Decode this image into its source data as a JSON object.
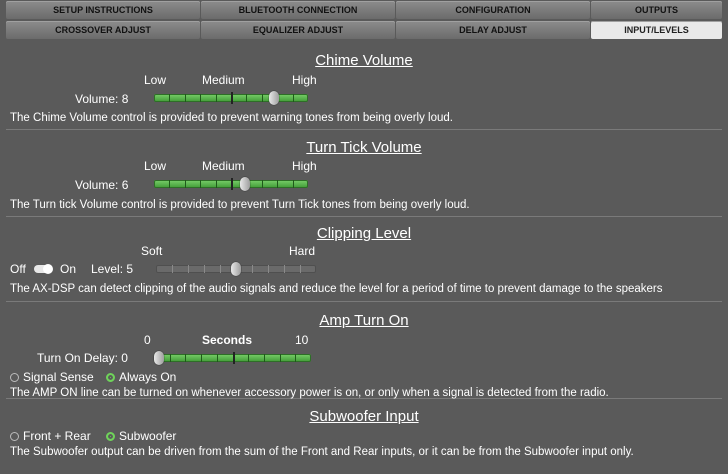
{
  "tabs": {
    "row1": [
      "SETUP INSTRUCTIONS",
      "BLUETOOTH CONNECTION",
      "CONFIGURATION",
      "OUTPUTS"
    ],
    "row2": [
      "CROSSOVER ADJUST",
      "EQUALIZER ADJUST",
      "DELAY ADJUST",
      "INPUT/LEVELS"
    ],
    "active": "INPUT/LEVELS"
  },
  "chime": {
    "title": "Chime Volume",
    "low": "Low",
    "medium": "Medium",
    "high": "High",
    "volume_label": "Volume: 8",
    "value": 8,
    "min": 0,
    "max": 10,
    "desc": "The Chime Volume control is provided to prevent warning tones from being overly loud."
  },
  "turn_tick": {
    "title": "Turn Tick Volume",
    "low": "Low",
    "medium": "Medium",
    "high": "High",
    "volume_label": "Volume: 6",
    "value": 6,
    "min": 0,
    "max": 10,
    "desc": "The Turn tick Volume control is provided to prevent Turn Tick tones from being overly loud."
  },
  "clipping": {
    "title": "Clipping Level",
    "soft": "Soft",
    "hard": "Hard",
    "off": "Off",
    "on": "On",
    "level_label": "Level: 5",
    "value": 5,
    "min": 0,
    "max": 10,
    "toggle_state": "on",
    "desc": "The AX-DSP can detect clipping of the audio signals and reduce the level for a period of time to prevent damage to the speakers"
  },
  "amp": {
    "title": "Amp Turn On",
    "min_label": "0",
    "unit_label": "Seconds",
    "max_label": "10",
    "delay_label": "Turn On Delay: 0",
    "value": 0,
    "min": 0,
    "max": 10,
    "options": [
      "Signal Sense",
      "Always On"
    ],
    "selected": "Always On",
    "desc": "The AMP ON line can be turned on whenever accessory power is on, or only when a signal is detected from the radio."
  },
  "sub": {
    "title": "Subwoofer Input",
    "options": [
      "Front + Rear",
      "Subwoofer"
    ],
    "selected": "Subwoofer",
    "desc": "The Subwoofer output can be driven from the sum of the Front and Rear inputs, or it can be from the Subwoofer input only."
  },
  "colors": {
    "accent": "#6fd35a",
    "background": "#5a5a5a",
    "tab": "#7a7a7a",
    "tab_active": "#e9e9e9"
  }
}
